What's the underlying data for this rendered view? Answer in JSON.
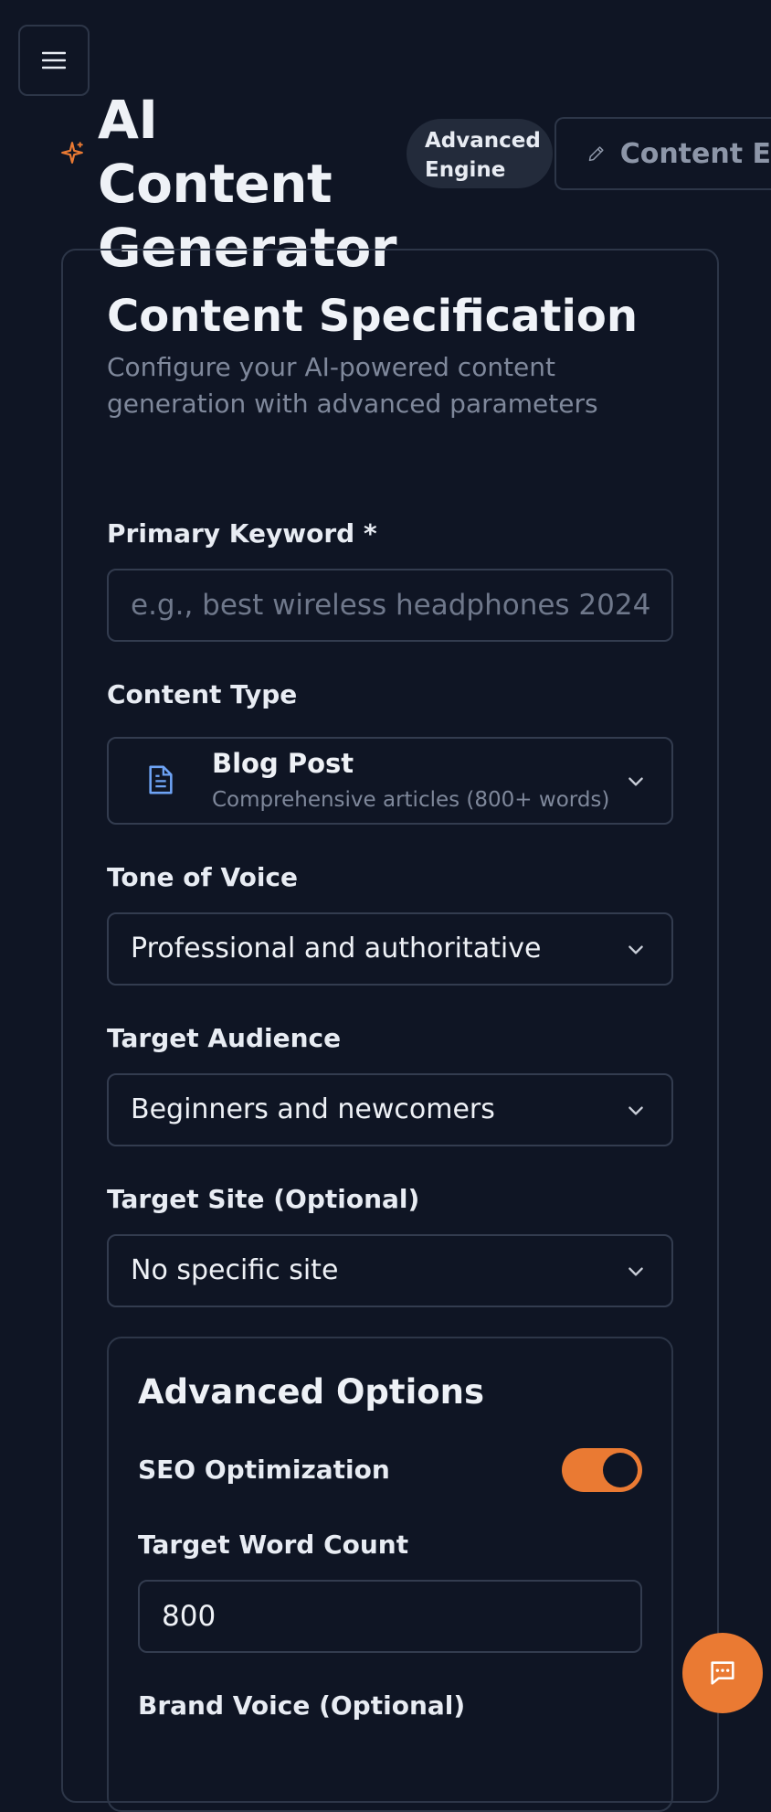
{
  "header": {
    "title": "AI Content Generator",
    "badge": "Advanced Engine",
    "tab_edit_label": "Content E"
  },
  "card": {
    "title": "Content Specification",
    "subtitle": "Configure your AI-powered content generation with advanced parameters"
  },
  "form": {
    "keyword": {
      "label": "Primary Keyword *",
      "placeholder": "e.g., best wireless headphones 2024",
      "value": ""
    },
    "content_type": {
      "label": "Content Type",
      "selected_title": "Blog Post",
      "selected_desc": "Comprehensive articles (800+ words)"
    },
    "tone": {
      "label": "Tone of Voice",
      "selected": "Professional and authoritative"
    },
    "audience": {
      "label": "Target Audience",
      "selected": "Beginners and newcomers"
    },
    "site": {
      "label": "Target Site (Optional)",
      "selected": "No specific site"
    }
  },
  "advanced": {
    "title": "Advanced Options",
    "seo_label": "SEO Optimization",
    "seo_enabled": true,
    "word_count_label": "Target Word Count",
    "word_count_value": "800",
    "brand_voice_label": "Brand Voice (Optional)"
  },
  "colors": {
    "background": "#0f1524",
    "accent": "#ea7a33",
    "border": "#2d3648",
    "muted_text": "#7f889b"
  }
}
